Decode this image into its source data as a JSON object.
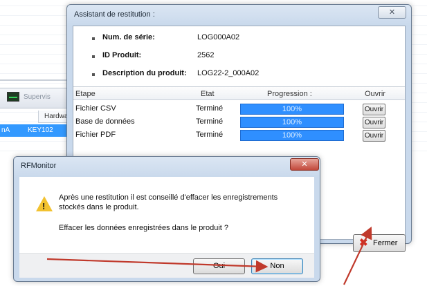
{
  "background_app": {
    "toolbar_label": "Supervis",
    "column_header": "Hardware",
    "row_left": "nA",
    "row_value": "KEY102"
  },
  "assistant": {
    "title": "Assistant de restitution :",
    "close_glyph": "✕",
    "info": [
      {
        "label": "Num. de série:",
        "value": "LOG000A02"
      },
      {
        "label": "ID Produit:",
        "value": "2562"
      },
      {
        "label": "Description du produit:",
        "value": "LOG22-2_000A02"
      }
    ],
    "table": {
      "headers": [
        "Etape",
        "Etat",
        "Progression :",
        "Ouvrir"
      ],
      "rows": [
        {
          "etape": "Fichier CSV",
          "etat": "Terminé",
          "progress_text": "100%",
          "progress": 100,
          "button": "Ouvrir"
        },
        {
          "etape": "Base de données",
          "etat": "Terminé",
          "progress_text": "100%",
          "progress": 100,
          "button": "Ouvrir"
        },
        {
          "etape": "Fichier PDF",
          "etat": "Terminé",
          "progress_text": "100%",
          "progress": 100,
          "button": "Ouvrir"
        }
      ]
    },
    "close_button": "Fermer"
  },
  "message_box": {
    "title": "RFMonitor",
    "close_glyph": "✕",
    "line1": "Après une restitution il est conseillé d'effacer les enregistrements",
    "line2": "stockés dans le produit.",
    "question": "Effacer les données enregistrées dans le produit ?",
    "yes": "Oui",
    "no": "Non"
  },
  "colors": {
    "progress_fill": "#2f8fff",
    "arrow": "#c0392b",
    "selection": "#3399ff"
  }
}
